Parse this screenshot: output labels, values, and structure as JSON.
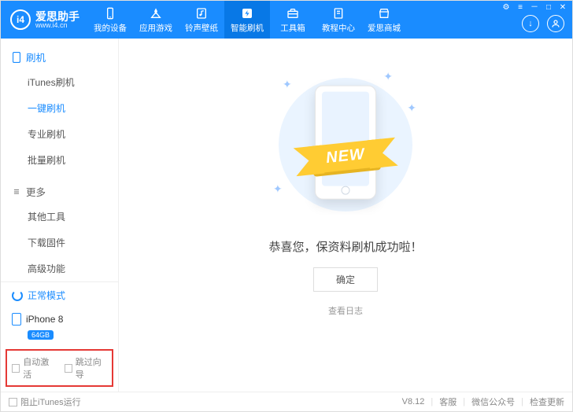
{
  "brand": {
    "logo_text": "i4",
    "title": "爱思助手",
    "url": "www.i4.cn"
  },
  "header_tabs": [
    {
      "label": "我的设备",
      "icon": "phone-icon"
    },
    {
      "label": "应用游戏",
      "icon": "apps-icon"
    },
    {
      "label": "铃声壁纸",
      "icon": "music-icon"
    },
    {
      "label": "智能刷机",
      "icon": "flash-icon",
      "active": true
    },
    {
      "label": "工具箱",
      "icon": "toolbox-icon"
    },
    {
      "label": "教程中心",
      "icon": "book-icon"
    },
    {
      "label": "爱思商城",
      "icon": "shop-icon"
    }
  ],
  "sidebar": {
    "section1": {
      "title": "刷机",
      "items": [
        "iTunes刷机",
        "一键刷机",
        "专业刷机",
        "批量刷机"
      ],
      "active_index": 1
    },
    "section2": {
      "title": "更多",
      "items": [
        "其他工具",
        "下载固件",
        "高级功能"
      ]
    },
    "mode_label": "正常模式",
    "device_name": "iPhone 8",
    "device_badge": "64GB",
    "check1": "自动激活",
    "check2": "跳过向导"
  },
  "main": {
    "ribbon_text": "NEW",
    "success_msg": "恭喜您，保资料刷机成功啦！",
    "ok_label": "确定",
    "log_label": "查看日志"
  },
  "footer": {
    "block_itunes": "阻止iTunes运行",
    "version": "V8.12",
    "support": "客服",
    "wechat": "微信公众号",
    "update": "检查更新"
  }
}
